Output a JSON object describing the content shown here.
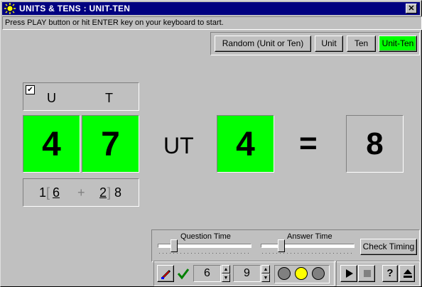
{
  "window": {
    "title": "UNITS & TENS : UNIT-TEN",
    "close_label": "✕",
    "status_text": "Press PLAY button or hit ENTER key on your keyboard to start."
  },
  "modes": {
    "items": [
      {
        "label": "Random (Unit or Ten)",
        "selected": false
      },
      {
        "label": "Unit",
        "selected": false
      },
      {
        "label": "Ten",
        "selected": false
      },
      {
        "label": "Unit-Ten",
        "selected": true
      }
    ]
  },
  "colors": {
    "accent_green": "#00ff00",
    "titlebar": "#000080",
    "face": "#c0c0c0",
    "light_yellow": "#ffff00",
    "light_gray": "#808080"
  },
  "digits": {
    "header_u": "U",
    "header_t": "T",
    "checkbox_checked": true,
    "unit_value": "4",
    "ten_value": "7",
    "op_label": "UT",
    "answer_digit": "4",
    "equals": "=",
    "result": "8"
  },
  "hint": {
    "first_digit": "1",
    "first_bracket": "[",
    "first_underlined": "6",
    "plus": "+",
    "second_digit": "2",
    "second_bracket": "]",
    "second_trail": "8"
  },
  "timing": {
    "question_label": "Question Time",
    "answer_label": "Answer Time",
    "question_level": 0.15,
    "answer_level": 0.2,
    "check_button": "Check Timing"
  },
  "toolbar": {
    "brush_icon": "brush-icon",
    "check_icon": "checkmark-icon",
    "value1": "6",
    "value2": "9",
    "lights": [
      "gray",
      "yellow",
      "gray"
    ],
    "play_icon": "play-icon",
    "stop_icon": "stop-icon",
    "help_label": "?",
    "eject_icon": "eject-icon"
  }
}
